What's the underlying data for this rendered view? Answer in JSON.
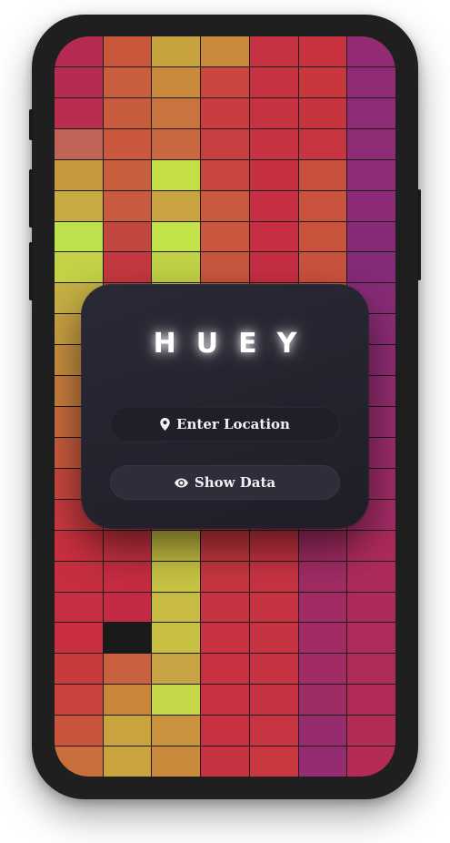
{
  "app": {
    "title": "HUEY"
  },
  "actions": {
    "location_label": "Enter Location",
    "location_icon": "map-pin-icon",
    "show_data_label": "Show Data",
    "show_data_icon": "eye-icon"
  },
  "colors": {
    "card_bg": "#24232e",
    "button_bg": "#1f1e29",
    "text": "#ffffff"
  },
  "grid": {
    "columns": 7,
    "rows": 24,
    "cells": [
      [
        "#b62b52",
        "#c9573c",
        "#c7a33e",
        "#c98a3e",
        "#c73242",
        "#c8323f",
        "#922b73"
      ],
      [
        "#b62b52",
        "#c85e3d",
        "#c98a3d",
        "#c9473f",
        "#c73242",
        "#c9363c",
        "#902c75"
      ],
      [
        "#b92e4f",
        "#c85d3e",
        "#c9743e",
        "#c93c40",
        "#c73242",
        "#c8343d",
        "#8f2c77"
      ],
      [
        "#c06458",
        "#c9583e",
        "#c9673e",
        "#c93e40",
        "#c73242",
        "#c8343f",
        "#8f2c76"
      ],
      [
        "#c7993e",
        "#c75f3e",
        "#c4df45",
        "#c9463f",
        "#c72f43",
        "#c8503e",
        "#8e2c77"
      ],
      [
        "#c7ab40",
        "#c85a3f",
        "#c9a33f",
        "#c95a3f",
        "#c72f44",
        "#c9533e",
        "#8c2c78"
      ],
      [
        "#bde14a",
        "#c2483f",
        "#c2e448",
        "#c9583f",
        "#c72e44",
        "#c9543e",
        "#892a79"
      ],
      [
        "#c3d247",
        "#c4393f",
        "#c3d346",
        "#c9573f",
        "#c72e44",
        "#c9533e",
        "#862a7a"
      ],
      [
        "#c6b044",
        "#c53940",
        "#c5c045",
        "#c9563f",
        "#c73043",
        "#c9513e",
        "#892b78"
      ],
      [
        "#c7a042",
        "#c53a40",
        "#c6b145",
        "#c9553f",
        "#c73243",
        "#c94f3e",
        "#8c2c77"
      ],
      [
        "#c88f40",
        "#c63b40",
        "#c7a244",
        "#c9543f",
        "#c73343",
        "#c94c3e",
        "#902c74"
      ],
      [
        "#c97e3f",
        "#c63c40",
        "#c79244",
        "#c9533f",
        "#c73443",
        "#c9493e",
        "#942c71"
      ],
      [
        "#c96c3e",
        "#c73d40",
        "#c88344",
        "#c9513f",
        "#c73543",
        "#c9473e",
        "#982c6e"
      ],
      [
        "#c95b3e",
        "#c73e40",
        "#c87444",
        "#c9503f",
        "#c73643",
        "#c9443e",
        "#9c2c6b"
      ],
      [
        "#c9483e",
        "#c73f40",
        "#c86444",
        "#c94e3f",
        "#c73643",
        "#c9413e",
        "#a02c68"
      ],
      [
        "#c93a3f",
        "#c73f41",
        "#c65244",
        "#c94c3f",
        "#c73743",
        "#c93e3e",
        "#a42c65"
      ],
      [
        "#c9303f",
        "#c63241",
        "#c7c043",
        "#c9373f",
        "#c73343",
        "#a12c63",
        "#ad2b5c"
      ],
      [
        "#c72f41",
        "#c62c42",
        "#c8c443",
        "#c83640",
        "#c73343",
        "#a12c63",
        "#ad2b5c"
      ],
      [
        "#c72e43",
        "#c52a44",
        "#c7bb44",
        "#c83341",
        "#c73343",
        "#a32b63",
        "#ad2b5c"
      ],
      [
        "#c92f40",
        "#1a1a1a",
        "#c7c043",
        "#c83142",
        "#c73343",
        "#a32b63",
        "#ae2c5b"
      ],
      [
        "#c93a3c",
        "#c9603e",
        "#c7a344",
        "#c83142",
        "#c73343",
        "#a22b63",
        "#af2c59"
      ],
      [
        "#c9443c",
        "#c9853c",
        "#c5d646",
        "#c83142",
        "#c83343",
        "#9e2c65",
        "#b02b57"
      ],
      [
        "#c9553c",
        "#c9a43e",
        "#c9923c",
        "#c73142",
        "#c83542",
        "#962b6d",
        "#b22c55"
      ],
      [
        "#c96f3b",
        "#c9a43e",
        "#c98a3c",
        "#c83341",
        "#c8383e",
        "#952c71",
        "#b42b53"
      ]
    ]
  }
}
